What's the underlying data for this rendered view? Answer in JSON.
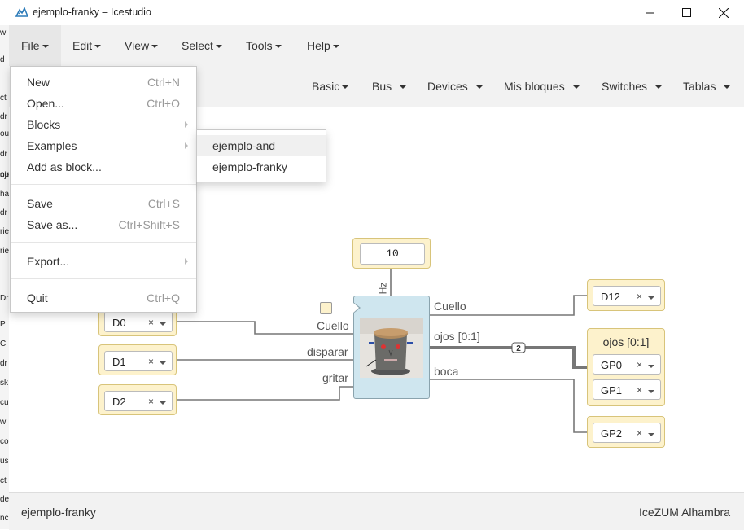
{
  "window": {
    "title": "ejemplo-franky – Icestudio",
    "controls": {
      "minimize_icon": "minimize-icon",
      "maximize_icon": "maximize-icon",
      "close_icon": "close-icon"
    }
  },
  "background_app_strip": [
    "w",
    "d",
    "ct",
    "dr",
    "ou",
    "dr",
    "ou",
    "oje",
    "ha",
    "dr",
    "rie",
    "rie",
    "Dr",
    "P",
    "C",
    "dr",
    "sk",
    "cu",
    "w",
    "co",
    "us",
    "ct",
    "de",
    "nc"
  ],
  "menubar": {
    "items": [
      {
        "label": "File",
        "active": true
      },
      {
        "label": "Edit"
      },
      {
        "label": "View"
      },
      {
        "label": "Select"
      },
      {
        "label": "Tools"
      },
      {
        "label": "Help"
      }
    ]
  },
  "toolbar": {
    "items": [
      {
        "label": "Basic"
      },
      {
        "label": "Bus"
      },
      {
        "label": "Devices"
      },
      {
        "label": "Mis bloques"
      },
      {
        "label": "Switches"
      },
      {
        "label": "Tablas"
      }
    ]
  },
  "file_menu": {
    "items": [
      {
        "label": "New",
        "shortcut": "Ctrl+N"
      },
      {
        "label": "Open...",
        "shortcut": "Ctrl+O"
      },
      {
        "label": "Blocks",
        "submenu": true
      },
      {
        "label": "Examples",
        "submenu": true
      },
      {
        "label": "Add as block..."
      },
      {
        "label": "Save",
        "shortcut": "Ctrl+S"
      },
      {
        "label": "Save as...",
        "shortcut": "Ctrl+Shift+S"
      },
      {
        "label": "Export...",
        "submenu": true
      },
      {
        "label": "Quit",
        "shortcut": "Ctrl+Q"
      }
    ]
  },
  "examples_submenu": {
    "items": [
      {
        "label": "ejemplo-and",
        "highlighted": true
      },
      {
        "label": "ejemplo-franky"
      }
    ]
  },
  "circuit": {
    "constant": {
      "value": "10",
      "port_label": "Hz"
    },
    "inputs": [
      {
        "pin": "D0",
        "clear": "×"
      },
      {
        "pin": "D1",
        "clear": "×"
      },
      {
        "pin": "D2",
        "clear": "×"
      }
    ],
    "franky": {
      "left_ports": [
        "Cuello",
        "disparar",
        "gritar"
      ],
      "right_ports": [
        "Cuello",
        "ojos [0:1]",
        "boca"
      ]
    },
    "bus_width_label": "2",
    "outputs": {
      "cuello": {
        "pin": "D12",
        "clear": "×"
      },
      "ojos": {
        "title": "ojos [0:1]",
        "pins": [
          "GP0",
          "GP1"
        ],
        "clear": "×"
      },
      "boca": {
        "pin": "GP2",
        "clear": "×"
      }
    },
    "colors": {
      "block_bg": "#fdf2cc",
      "franky_bg": "#cfe6ef",
      "wire": "#777777"
    }
  },
  "footer": {
    "file_name": "ejemplo-franky",
    "board": "IceZUM Alhambra"
  }
}
